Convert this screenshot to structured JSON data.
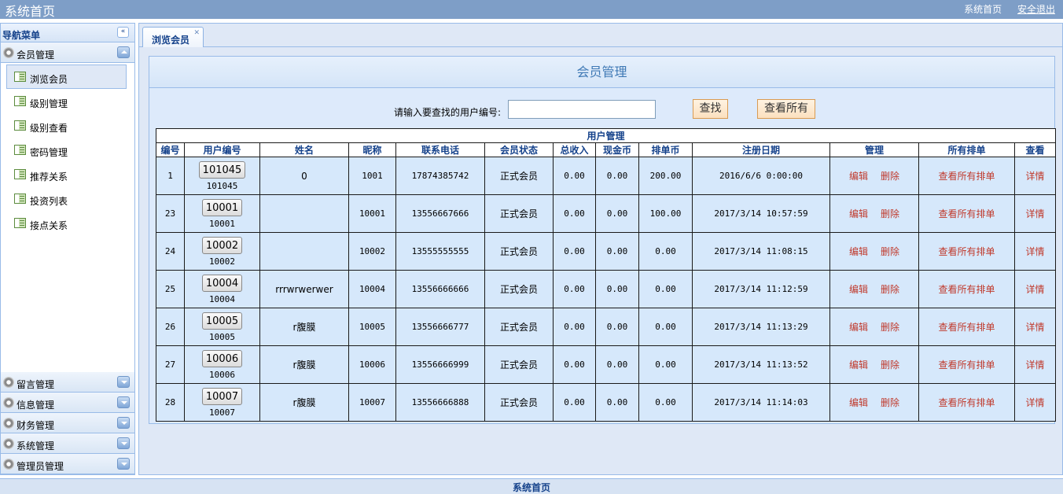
{
  "topbar": {
    "title": "系统首页",
    "home_link": "系统首页",
    "logout_link": "安全退出"
  },
  "sidebar": {
    "header": "导航菜单",
    "member_panel": "会员管理",
    "items": [
      {
        "label": "浏览会员",
        "active": true
      },
      {
        "label": "级别管理"
      },
      {
        "label": "级别查看"
      },
      {
        "label": "密码管理"
      },
      {
        "label": "推荐关系"
      },
      {
        "label": "投资列表"
      },
      {
        "label": "接点关系"
      }
    ],
    "panels": [
      "留言管理",
      "信息管理",
      "财务管理",
      "系统管理",
      "管理员管理"
    ]
  },
  "tab": {
    "label": "浏览会员"
  },
  "page": {
    "title": "会员管理",
    "search_label": "请输入要查找的用户编号:",
    "search_value": "",
    "find_button": "查找",
    "all_button": "查看所有"
  },
  "table": {
    "caption": "用户管理",
    "headers": [
      "编号",
      "用户编号",
      "姓名",
      "昵称",
      "联系电话",
      "会员状态",
      "总收入",
      "现金币",
      "排单币",
      "注册日期",
      "管理",
      "所有排单",
      "查看"
    ],
    "edit_label": "编辑",
    "delete_label": "删除",
    "all_orders_label": "查看所有排单",
    "detail_label": "详情",
    "rows": [
      {
        "id": "1",
        "uid": "101045",
        "uid_sub": "101045",
        "name": "0",
        "nick": "1001",
        "phone": "17874385742",
        "status": "正式会员",
        "income": "0.00",
        "cash": "0.00",
        "queue": "200.00",
        "date": "2016/6/6 0:00:00"
      },
      {
        "id": "23",
        "uid": "10001",
        "uid_sub": "10001",
        "name": "",
        "nick": "10001",
        "phone": "13556667666",
        "status": "正式会员",
        "income": "0.00",
        "cash": "0.00",
        "queue": "100.00",
        "date": "2017/3/14 10:57:59"
      },
      {
        "id": "24",
        "uid": "10002",
        "uid_sub": "10002",
        "name": "",
        "nick": "10002",
        "phone": "13555555555",
        "status": "正式会员",
        "income": "0.00",
        "cash": "0.00",
        "queue": "0.00",
        "date": "2017/3/14 11:08:15"
      },
      {
        "id": "25",
        "uid": "10004",
        "uid_sub": "10004",
        "name": "rrrwrwerwer",
        "nick": "10004",
        "phone": "13556666666",
        "status": "正式会员",
        "income": "0.00",
        "cash": "0.00",
        "queue": "0.00",
        "date": "2017/3/14 11:12:59"
      },
      {
        "id": "26",
        "uid": "10005",
        "uid_sub": "10005",
        "name": "r腹膜",
        "nick": "10005",
        "phone": "13556666777",
        "status": "正式会员",
        "income": "0.00",
        "cash": "0.00",
        "queue": "0.00",
        "date": "2017/3/14 11:13:29"
      },
      {
        "id": "27",
        "uid": "10006",
        "uid_sub": "10006",
        "name": "r腹膜",
        "nick": "10006",
        "phone": "13556666999",
        "status": "正式会员",
        "income": "0.00",
        "cash": "0.00",
        "queue": "0.00",
        "date": "2017/3/14 11:13:52"
      },
      {
        "id": "28",
        "uid": "10007",
        "uid_sub": "10007",
        "name": "r腹膜",
        "nick": "10007",
        "phone": "13556666888",
        "status": "正式会员",
        "income": "0.00",
        "cash": "0.00",
        "queue": "0.00",
        "date": "2017/3/14 11:14:03"
      }
    ]
  },
  "footer": {
    "text": "系统首页"
  }
}
